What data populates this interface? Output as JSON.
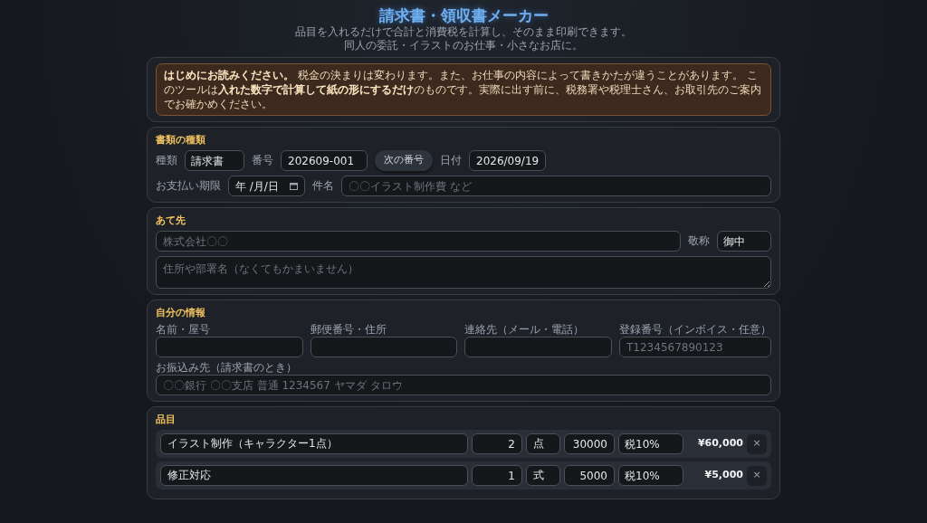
{
  "title": "請求書・領収書メーカー",
  "subtitle_lines": [
    "品目を入れるだけで合計と消費税を計算し、そのまま印刷できます。",
    "同人の委託・イラストのお仕事・小さなお店に。"
  ],
  "notice": "**はじめにお読みください。** 税金の決まりは変わります。また、お仕事の内容によって書きかたが違うことがあります。 このツールは**入れた数字で計算して紙の形にするだけ**のものです。実際に出す前に、税務署や税理士さん、お取引先のご案内でお確かめください。",
  "document": {
    "heading": "書類の種類",
    "type": {
      "label": "種類",
      "value": "請求書"
    },
    "number": {
      "label": "番号",
      "value": "202609-001"
    },
    "next_button": "次の番号",
    "date": {
      "label": "日付",
      "value": "2026/09/19"
    },
    "due": {
      "label": "お支払い期限",
      "value": "年 /月/日"
    },
    "subject": {
      "label": "件名",
      "placeholder": "〇〇イラスト制作費 など"
    }
  },
  "recipient": {
    "heading": "あて先",
    "name": {
      "placeholder": "株式会社〇〇"
    },
    "honorific": {
      "label": "敬称",
      "value": "御中"
    },
    "address": {
      "placeholder": "住所や部署名（なくてもかまいません）"
    }
  },
  "sender": {
    "heading": "自分の情報",
    "fields": [
      {
        "label": "名前・屋号"
      },
      {
        "label": "郵便番号・住所"
      },
      {
        "label": "連絡先（メール・電話）"
      },
      {
        "label": "登録番号（インボイス・任意）",
        "placeholder": "T1234567890123"
      }
    ],
    "bank": {
      "label": "お振込み先（請求書のとき）",
      "placeholder": "〇〇銀行 〇〇支店 普通 1234567 ヤマダ タロウ"
    }
  },
  "items": {
    "heading": "品目",
    "remove_label": "×",
    "rows": [
      {
        "name": "イラスト制作（キャラクター1点）",
        "qty": "2",
        "unit": "点",
        "price": "30000",
        "tax": "税10%",
        "amount": "¥60,000"
      },
      {
        "name": "修正対応",
        "qty": "1",
        "unit": "式",
        "price": "5000",
        "tax": "税10%",
        "amount": "¥5,000"
      }
    ]
  }
}
